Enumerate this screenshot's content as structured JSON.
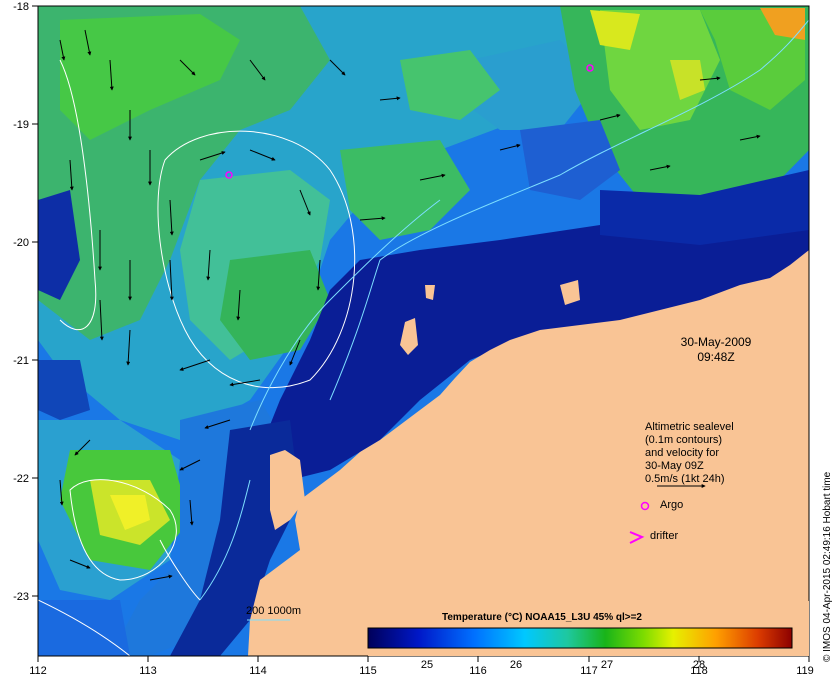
{
  "map": {
    "x_ticks": [
      "112",
      "113",
      "114",
      "115",
      "116",
      "117",
      "118",
      "119"
    ],
    "y_ticks": [
      "-18",
      "-19",
      "-20",
      "-21",
      "-22",
      "-23"
    ],
    "date": "30-May-2009",
    "time": "09:48Z",
    "legend_lines": [
      "Altimetric sealevel",
      "(0.1m contours)",
      "and velocity for",
      "30-May 09Z",
      "0.5m/s (1kt 24h)"
    ],
    "argo_label": "Argo",
    "drifter_label": "drifter",
    "depth_label": "200  1000m",
    "colorbar_title": "Temperature (°C) NOAA15_L3U 45% ql>=2",
    "colorbar_ticks": [
      "25",
      "26",
      "27",
      "28"
    ],
    "credit": "© IMOS 04-Apr-2015 02:49:16 Hobart time",
    "colors": {
      "land": "#f9c495",
      "argo": "#ff00ff",
      "contour": "#ffffff",
      "isobath": "#7ddfff"
    }
  }
}
